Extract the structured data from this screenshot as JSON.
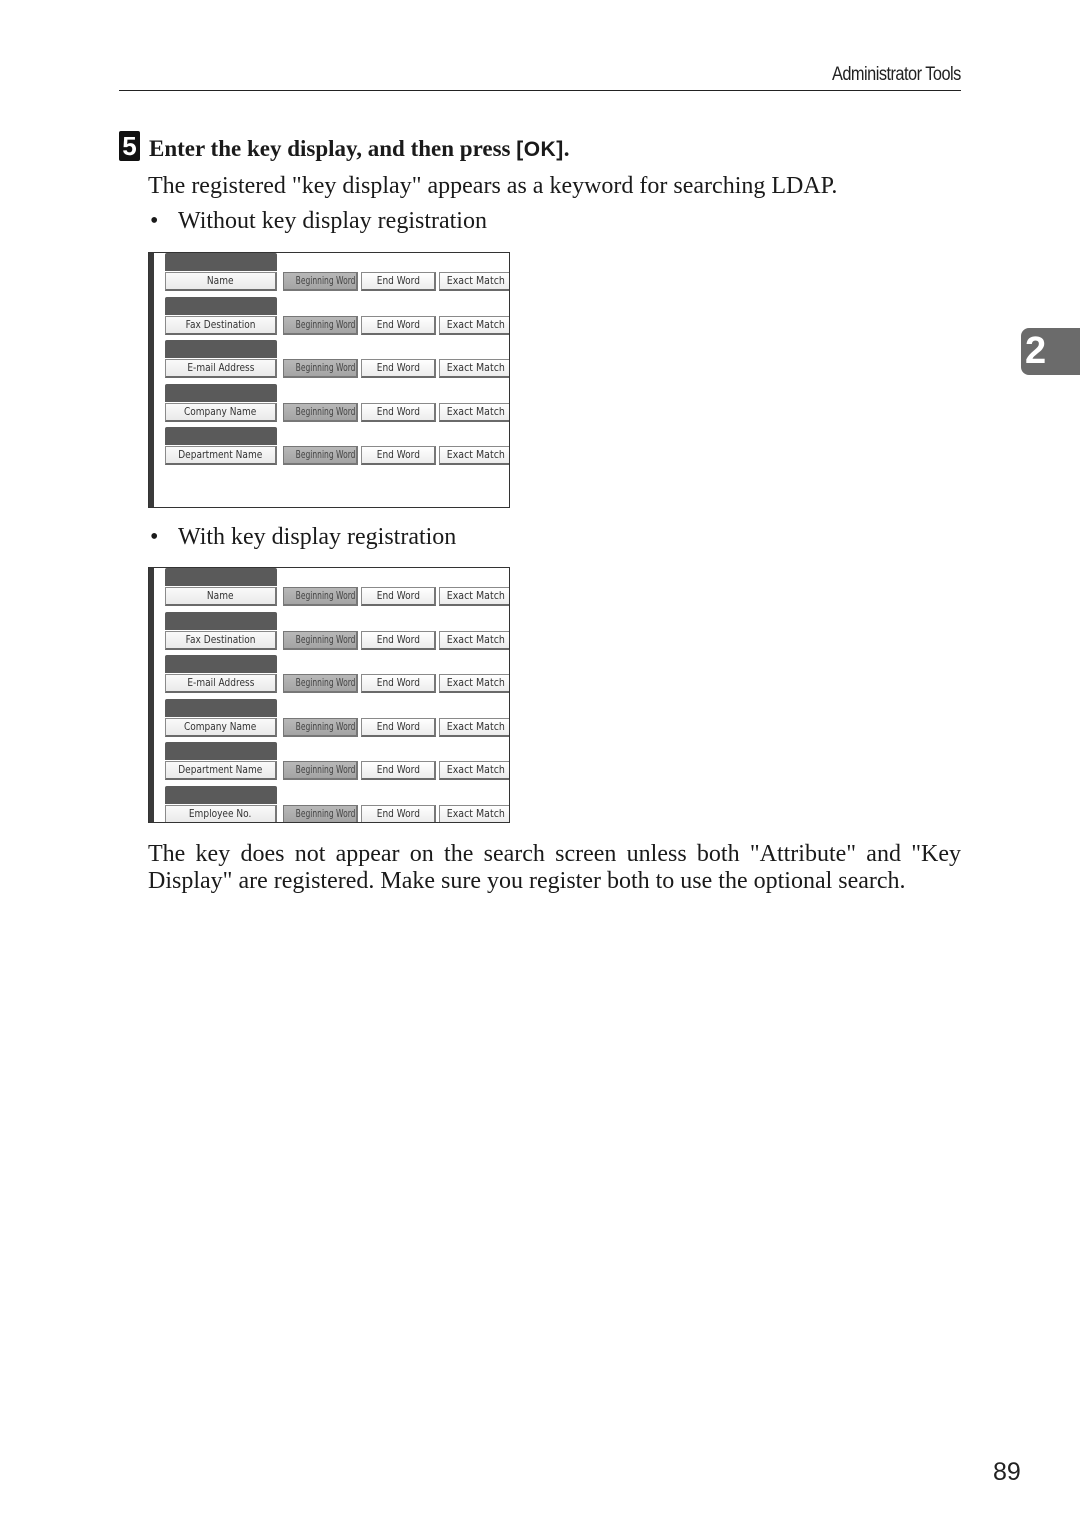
{
  "header": {
    "section_title": "Administrator Tools"
  },
  "step": {
    "number": "5",
    "title_prefix": "Enter the key display, and then press ",
    "title_key": "[OK]",
    "title_suffix": ".",
    "description": "The registered \"key display\" appears as a keyword for searching LDAP."
  },
  "bullets": [
    {
      "symbol": "•",
      "label": "Without key display registration"
    },
    {
      "symbol": "•",
      "label": "With key display registration"
    }
  ],
  "screens": [
    {
      "name": "without-key-display",
      "match_options": [
        "Beginning Word",
        "End Word",
        "Exact Match"
      ],
      "selected_option": "Beginning Word",
      "rows": [
        {
          "attribute": "Name"
        },
        {
          "attribute": "Fax Destination"
        },
        {
          "attribute": "E-mail Address"
        },
        {
          "attribute": "Company Name"
        },
        {
          "attribute": "Department Name"
        }
      ]
    },
    {
      "name": "with-key-display",
      "match_options": [
        "Beginning Word",
        "End Word",
        "Exact Match"
      ],
      "selected_option": "Beginning Word",
      "rows": [
        {
          "attribute": "Name"
        },
        {
          "attribute": "Fax Destination"
        },
        {
          "attribute": "E-mail Address"
        },
        {
          "attribute": "Company Name"
        },
        {
          "attribute": "Department Name"
        },
        {
          "attribute": "Employee No."
        }
      ]
    }
  ],
  "note": "The key does not appear on the search screen unless both \"Attribute\" and \"Key Display\" are registered. Make sure you register both to use the optional search.",
  "chapter_tab": "2",
  "page_number": "89"
}
